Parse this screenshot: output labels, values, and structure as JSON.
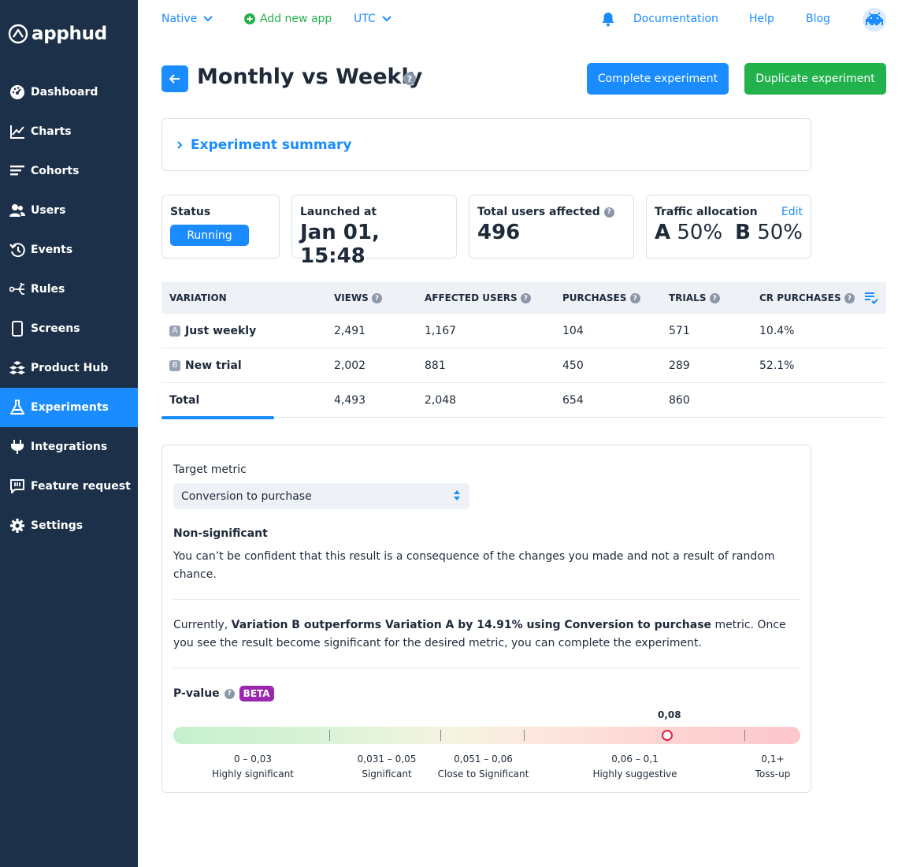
{
  "app": {
    "logo_text": "apphud"
  },
  "sidebar": {
    "items": [
      {
        "label": "Dashboard",
        "icon": "dashboard-icon"
      },
      {
        "label": "Charts",
        "icon": "chart-icon"
      },
      {
        "label": "Cohorts",
        "icon": "cohorts-icon"
      },
      {
        "label": "Users",
        "icon": "users-icon"
      },
      {
        "label": "Events",
        "icon": "events-icon"
      },
      {
        "label": "Rules",
        "icon": "rules-icon"
      },
      {
        "label": "Screens",
        "icon": "screens-icon"
      },
      {
        "label": "Product Hub",
        "icon": "product-hub-icon"
      },
      {
        "label": "Experiments",
        "icon": "experiments-icon",
        "active": true
      },
      {
        "label": "Integrations",
        "icon": "integrations-icon"
      },
      {
        "label": "Feature request",
        "icon": "feature-request-icon"
      },
      {
        "label": "Settings",
        "icon": "gear-icon"
      }
    ]
  },
  "topbar": {
    "platform": "Native",
    "add_app": "Add new app",
    "timezone": "UTC",
    "documentation": "Documentation",
    "help": "Help",
    "blog": "Blog"
  },
  "header": {
    "title": "Monthly vs Weekly",
    "complete_btn": "Complete experiment",
    "duplicate_btn": "Duplicate experiment"
  },
  "summary": {
    "title": "Experiment summary"
  },
  "stats": {
    "status_label": "Status",
    "status_value": "Running",
    "launched_label": "Launched at",
    "launched_value": "Jan 01, 15:48",
    "users_label": "Total users affected",
    "users_value": "496",
    "traffic_label": "Traffic allocation",
    "traffic_edit": "Edit",
    "traffic_a_letter": "A",
    "traffic_a_value": "50%",
    "traffic_b_letter": "B",
    "traffic_b_value": "50%"
  },
  "table": {
    "headers": {
      "variation": "VARIATION",
      "views": "VIEWS",
      "affected": "AFFECTED USERS",
      "purchases": "PURCHASES",
      "trials": "TRIALS",
      "cr": "CR PURCHASES"
    },
    "rows": [
      {
        "tag": "A",
        "name": "Just weekly",
        "views": "2,491",
        "affected": "1,167",
        "purchases": "104",
        "trials": "571",
        "cr": "10.4%"
      },
      {
        "tag": "B",
        "name": "New trial",
        "views": "2,002",
        "affected": "881",
        "purchases": "450",
        "trials": "289",
        "cr": "52.1%"
      }
    ],
    "total": {
      "name": "Total",
      "views": "4,493",
      "affected": "2,048",
      "purchases": "654",
      "trials": "860"
    }
  },
  "metric": {
    "label": "Target metric",
    "selected": "Conversion to purchase",
    "significance_title": "Non-significant",
    "significance_text": "You can’t be confident that this result is a consequence of the changes you made and not a result of random chance.",
    "current_prefix": "Currently, ",
    "current_bold": "Variation B outperforms Variation A by 14.91% using Conversion to purchase",
    "current_suffix": " metric. Once you see the result become significant for the desired metric, you can complete the experiment.",
    "pvalue_label": "P-value",
    "beta": "BETA",
    "pvalue": "0,08",
    "ranges": [
      {
        "range": "0 – 0,03",
        "label": "Highly significant"
      },
      {
        "range": "0,031 – 0,05",
        "label": "Significant"
      },
      {
        "range": "0,051 – 0,06",
        "label": "Close to Significant"
      },
      {
        "range": "0,06 – 0,1",
        "label": "Highly suggestive"
      },
      {
        "range": "0,1+",
        "label": "Toss-up"
      }
    ]
  }
}
